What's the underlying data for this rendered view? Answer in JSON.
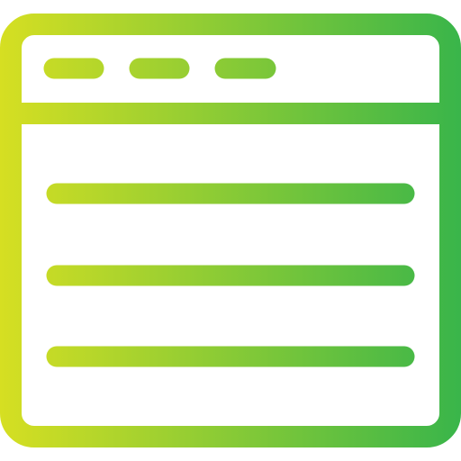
{
  "icon": {
    "name": "browser-window-icon",
    "gradient": {
      "start": "#D6DF22",
      "end": "#39B54A"
    },
    "background": "#FFFFFF"
  },
  "window": {
    "title_bar": {
      "buttons": [
        {
          "name": "window-dot-1"
        },
        {
          "name": "window-dot-2"
        },
        {
          "name": "window-dot-3"
        }
      ]
    },
    "content": {
      "lines": [
        {
          "name": "content-line-1"
        },
        {
          "name": "content-line-2"
        },
        {
          "name": "content-line-3"
        }
      ]
    }
  }
}
